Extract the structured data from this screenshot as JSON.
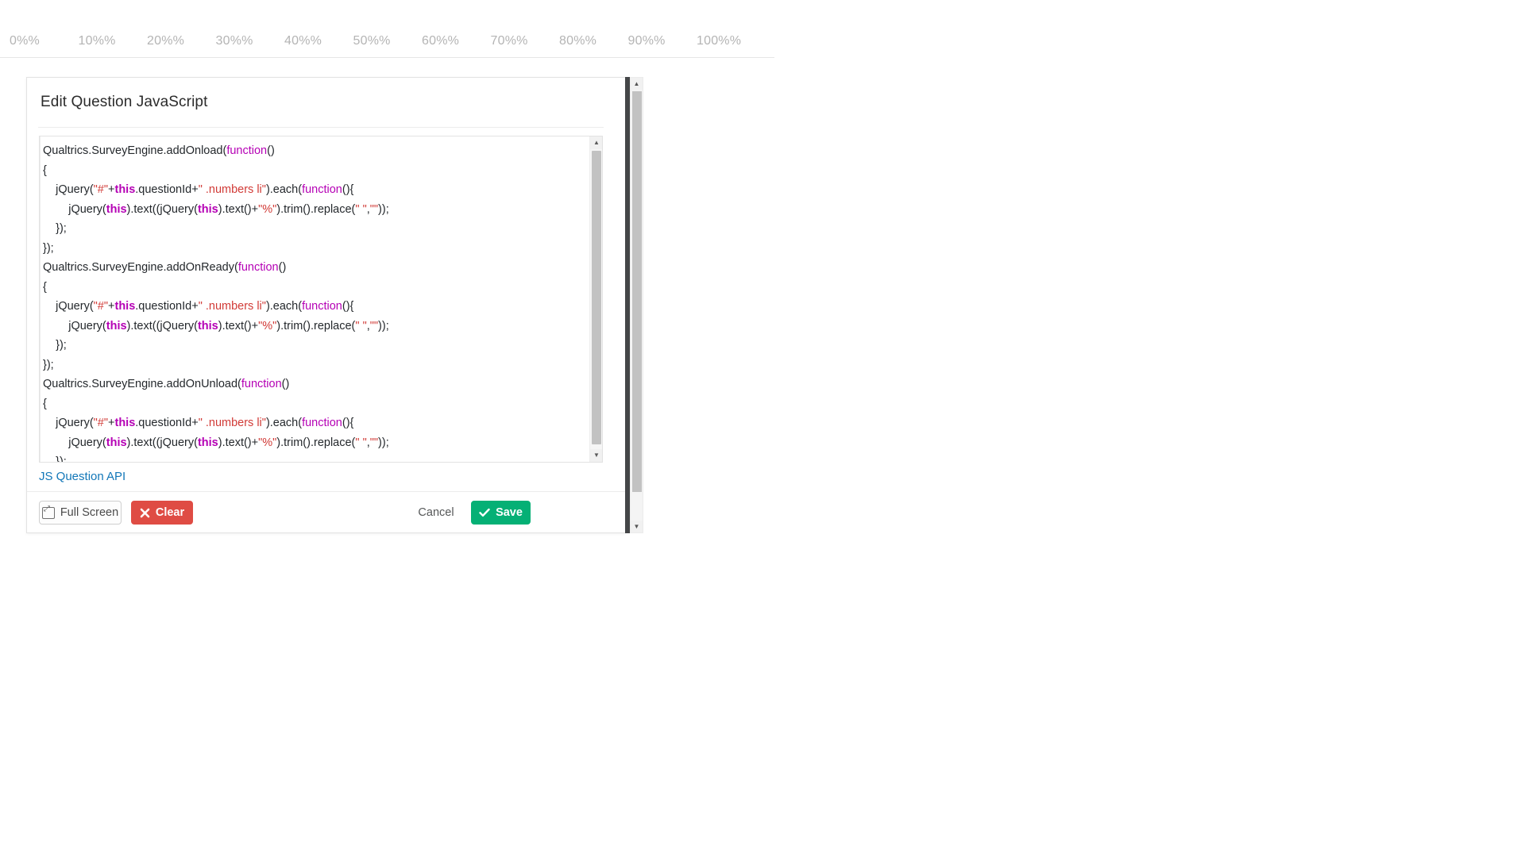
{
  "percent_scale": {
    "ticks": [
      "0%%",
      "10%%",
      "20%%",
      "30%%",
      "40%%",
      "50%%",
      "60%%",
      "70%%",
      "80%%",
      "90%%",
      "100%%"
    ]
  },
  "dialog": {
    "title": "Edit Question JavaScript",
    "api_link_label": "JS Question API"
  },
  "code": {
    "lines": [
      [
        {
          "t": "Qualtrics.SurveyEngine.addOnload(",
          "c": "plain"
        },
        {
          "t": "function",
          "c": "kw"
        },
        {
          "t": "()",
          "c": "plain"
        }
      ],
      [
        {
          "t": "{",
          "c": "plain"
        }
      ],
      [
        {
          "t": "    jQuery(",
          "c": "plain"
        },
        {
          "t": "\"#\"",
          "c": "str"
        },
        {
          "t": "+",
          "c": "plain"
        },
        {
          "t": "this",
          "c": "var"
        },
        {
          "t": ".questionId+",
          "c": "plain"
        },
        {
          "t": "\" .numbers li\"",
          "c": "sel"
        },
        {
          "t": ").each(",
          "c": "plain"
        },
        {
          "t": "function",
          "c": "kw"
        },
        {
          "t": "(){",
          "c": "plain"
        }
      ],
      [
        {
          "t": "        jQuery(",
          "c": "plain"
        },
        {
          "t": "this",
          "c": "var"
        },
        {
          "t": ").text((jQuery(",
          "c": "plain"
        },
        {
          "t": "this",
          "c": "var"
        },
        {
          "t": ").text()+",
          "c": "plain"
        },
        {
          "t": "\"%\"",
          "c": "str"
        },
        {
          "t": ").trim().replace(",
          "c": "plain"
        },
        {
          "t": "\" \"",
          "c": "str"
        },
        {
          "t": ",",
          "c": "plain"
        },
        {
          "t": "\"\"",
          "c": "str"
        },
        {
          "t": "));",
          "c": "plain"
        }
      ],
      [
        {
          "t": "    });",
          "c": "plain"
        }
      ],
      [
        {
          "t": "});",
          "c": "plain"
        }
      ],
      [
        {
          "t": "Qualtrics.SurveyEngine.addOnReady(",
          "c": "plain"
        },
        {
          "t": "function",
          "c": "kw"
        },
        {
          "t": "()",
          "c": "plain"
        }
      ],
      [
        {
          "t": "{",
          "c": "plain"
        }
      ],
      [
        {
          "t": "    jQuery(",
          "c": "plain"
        },
        {
          "t": "\"#\"",
          "c": "str"
        },
        {
          "t": "+",
          "c": "plain"
        },
        {
          "t": "this",
          "c": "var"
        },
        {
          "t": ".questionId+",
          "c": "plain"
        },
        {
          "t": "\" .numbers li\"",
          "c": "sel"
        },
        {
          "t": ").each(",
          "c": "plain"
        },
        {
          "t": "function",
          "c": "kw"
        },
        {
          "t": "(){",
          "c": "plain"
        }
      ],
      [
        {
          "t": "        jQuery(",
          "c": "plain"
        },
        {
          "t": "this",
          "c": "var"
        },
        {
          "t": ").text((jQuery(",
          "c": "plain"
        },
        {
          "t": "this",
          "c": "var"
        },
        {
          "t": ").text()+",
          "c": "plain"
        },
        {
          "t": "\"%\"",
          "c": "str"
        },
        {
          "t": ").trim().replace(",
          "c": "plain"
        },
        {
          "t": "\" \"",
          "c": "str"
        },
        {
          "t": ",",
          "c": "plain"
        },
        {
          "t": "\"\"",
          "c": "str"
        },
        {
          "t": "));",
          "c": "plain"
        }
      ],
      [
        {
          "t": "    });",
          "c": "plain"
        }
      ],
      [
        {
          "t": "});",
          "c": "plain"
        }
      ],
      [
        {
          "t": "Qualtrics.SurveyEngine.addOnUnload(",
          "c": "plain"
        },
        {
          "t": "function",
          "c": "kw"
        },
        {
          "t": "()",
          "c": "plain"
        }
      ],
      [
        {
          "t": "{",
          "c": "plain"
        }
      ],
      [
        {
          "t": "    jQuery(",
          "c": "plain"
        },
        {
          "t": "\"#\"",
          "c": "str"
        },
        {
          "t": "+",
          "c": "plain"
        },
        {
          "t": "this",
          "c": "var"
        },
        {
          "t": ".questionId+",
          "c": "plain"
        },
        {
          "t": "\" .numbers li\"",
          "c": "sel"
        },
        {
          "t": ").each(",
          "c": "plain"
        },
        {
          "t": "function",
          "c": "kw"
        },
        {
          "t": "(){",
          "c": "plain"
        }
      ],
      [
        {
          "t": "        jQuery(",
          "c": "plain"
        },
        {
          "t": "this",
          "c": "var"
        },
        {
          "t": ").text((jQuery(",
          "c": "plain"
        },
        {
          "t": "this",
          "c": "var"
        },
        {
          "t": ").text()+",
          "c": "plain"
        },
        {
          "t": "\"%\"",
          "c": "str"
        },
        {
          "t": ").trim().replace(",
          "c": "plain"
        },
        {
          "t": "\" \"",
          "c": "str"
        },
        {
          "t": ",",
          "c": "plain"
        },
        {
          "t": "\"\"",
          "c": "str"
        },
        {
          "t": "));",
          "c": "plain"
        }
      ],
      [
        {
          "t": "    });",
          "c": "plain"
        }
      ],
      [
        {
          "t": "});",
          "c": "plain"
        }
      ]
    ]
  },
  "footer": {
    "full_screen_label": "Full Screen",
    "clear_label": "Clear",
    "clear_icon": "close-x-icon",
    "cancel_label": "Cancel",
    "save_label": "Save",
    "save_icon": "checkmark-icon",
    "full_screen_icon": "expand-icon"
  },
  "scrollbars": {
    "up_arrow": "▲",
    "down_arrow": "▼"
  },
  "colors": {
    "save_green": "#05b075",
    "clear_red": "#df4c44",
    "link_blue": "#1277b8",
    "keyword_magenta": "#b500b5",
    "string_red": "#d13a36"
  }
}
